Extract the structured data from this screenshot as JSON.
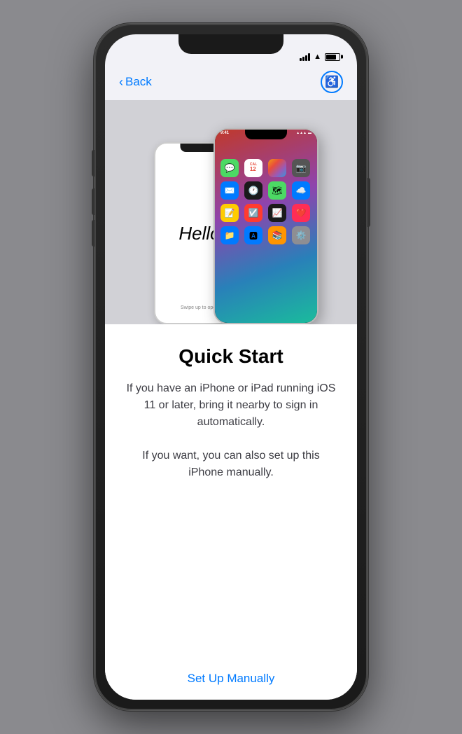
{
  "phone": {
    "nav": {
      "back_label": "Back",
      "accessibility_icon": "♿"
    },
    "illustration": {
      "back_phone": {
        "hello_text": "Hello",
        "swipe_text": "Swipe up to open"
      }
    },
    "content": {
      "title": "Quick Start",
      "description1": "If you have an iPhone or iPad running iOS 11 or later, bring it nearby to sign in automatically.",
      "description2": "If you want, you can also set up this iPhone manually.",
      "setup_manually_label": "Set Up Manually"
    },
    "home_screen": {
      "time": "9:41",
      "date_label": "12"
    }
  }
}
